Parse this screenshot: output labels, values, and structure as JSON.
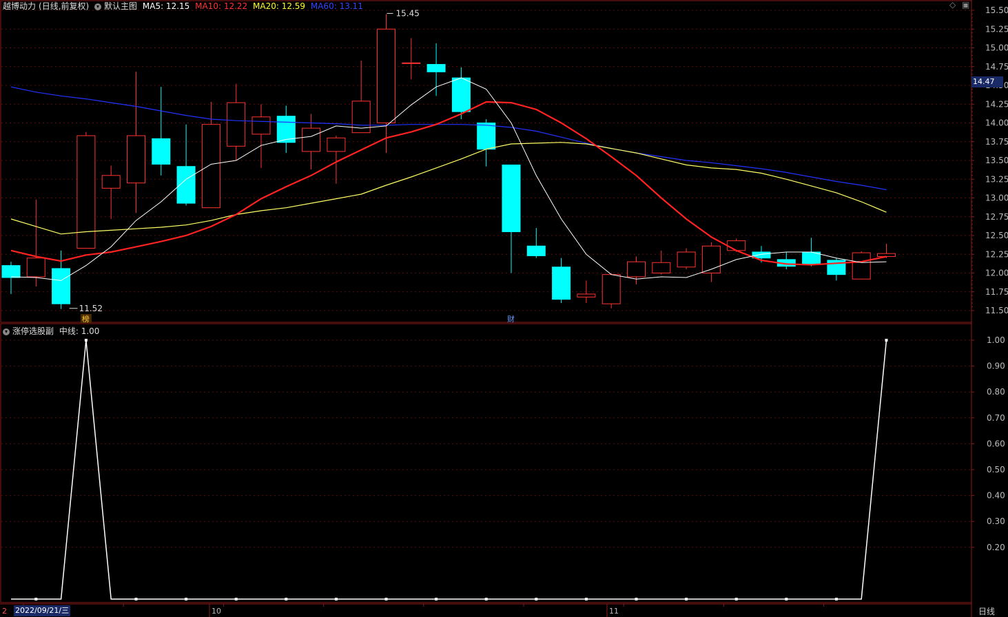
{
  "header": {
    "stock_name": "越博动力",
    "mode": "(日线,前复权)",
    "main_menu": "默认主图",
    "ma5": "MA5: 12.15",
    "ma10": "MA10: 12.22",
    "ma20": "MA20: 12.59",
    "ma60": "MA60: 13.11"
  },
  "sub_header": {
    "indicator": "涨停选股副",
    "mid_line": "中线: 1.00"
  },
  "price_axis": [
    "15.50",
    "15.25",
    "15.00",
    "14.75",
    "14.50",
    "14.25",
    "14.00",
    "13.75",
    "13.50",
    "13.25",
    "13.00",
    "12.75",
    "12.50",
    "12.25",
    "12.00",
    "11.75",
    "11.50"
  ],
  "current_price": "14.47",
  "indicator_axis": [
    "1.00",
    "0.90",
    "0.80",
    "0.70",
    "0.60",
    "0.50",
    "0.40",
    "0.30",
    "0.20"
  ],
  "annotations": {
    "high": "15.45",
    "low": "11.52",
    "bang": "榜",
    "cai": "财"
  },
  "x_axis": {
    "date": "2022/09/21/三",
    "left_mark": "2",
    "oct": "10",
    "nov": "11"
  },
  "period_button": "日线",
  "colors": {
    "up": "#ff3333",
    "down": "#00ffff",
    "ma5": "#ffffff",
    "ma10": "#ff2222",
    "ma20": "#ffff66",
    "ma60": "#2233ff",
    "axis": "#8b1a1a",
    "grid": "#5a0f0f"
  },
  "chart_data": [
    {
      "type": "candlestick",
      "price_range": [
        11.45,
        15.55
      ],
      "candles": [
        {
          "o": 12.1,
          "h": 12.15,
          "l": 11.72,
          "c": 11.94
        },
        {
          "o": 11.95,
          "h": 12.98,
          "l": 11.82,
          "c": 12.2
        },
        {
          "o": 12.06,
          "h": 12.3,
          "l": 11.52,
          "c": 11.59
        },
        {
          "o": 12.33,
          "h": 13.88,
          "l": 12.33,
          "c": 13.83
        },
        {
          "o": 13.13,
          "h": 13.43,
          "l": 12.72,
          "c": 13.3
        },
        {
          "o": 13.2,
          "h": 14.68,
          "l": 12.8,
          "c": 13.83
        },
        {
          "o": 13.79,
          "h": 14.48,
          "l": 13.3,
          "c": 13.45
        },
        {
          "o": 13.42,
          "h": 13.98,
          "l": 12.9,
          "c": 12.93
        },
        {
          "o": 12.87,
          "h": 14.28,
          "l": 12.87,
          "c": 13.98
        },
        {
          "o": 13.69,
          "h": 14.52,
          "l": 13.5,
          "c": 14.27
        },
        {
          "o": 13.85,
          "h": 14.25,
          "l": 13.4,
          "c": 14.08
        },
        {
          "o": 14.09,
          "h": 14.23,
          "l": 13.6,
          "c": 13.74
        },
        {
          "o": 13.62,
          "h": 14.12,
          "l": 13.38,
          "c": 13.93
        },
        {
          "o": 13.62,
          "h": 13.83,
          "l": 13.19,
          "c": 13.8
        },
        {
          "o": 13.87,
          "h": 14.83,
          "l": 13.87,
          "c": 14.29
        },
        {
          "o": 14.0,
          "h": 15.45,
          "l": 13.6,
          "c": 15.25
        },
        {
          "o": 14.8,
          "h": 15.13,
          "l": 14.58,
          "c": 14.8
        },
        {
          "o": 14.78,
          "h": 15.06,
          "l": 14.36,
          "c": 14.68
        },
        {
          "o": 14.6,
          "h": 14.74,
          "l": 14.05,
          "c": 14.15
        },
        {
          "o": 14.0,
          "h": 14.05,
          "l": 13.42,
          "c": 13.65
        },
        {
          "o": 13.44,
          "h": 13.44,
          "l": 12.0,
          "c": 12.55
        },
        {
          "o": 12.36,
          "h": 12.6,
          "l": 12.2,
          "c": 12.23
        },
        {
          "o": 12.08,
          "h": 12.2,
          "l": 11.6,
          "c": 11.65
        },
        {
          "o": 11.68,
          "h": 11.9,
          "l": 11.6,
          "c": 11.72
        },
        {
          "o": 11.59,
          "h": 12.0,
          "l": 11.53,
          "c": 11.98
        },
        {
          "o": 11.95,
          "h": 12.22,
          "l": 11.85,
          "c": 12.15
        },
        {
          "o": 12.0,
          "h": 12.3,
          "l": 11.98,
          "c": 12.14
        },
        {
          "o": 12.08,
          "h": 12.33,
          "l": 12.05,
          "c": 12.28
        },
        {
          "o": 12.0,
          "h": 12.41,
          "l": 11.88,
          "c": 12.36
        },
        {
          "o": 12.3,
          "h": 12.46,
          "l": 12.28,
          "c": 12.43
        },
        {
          "o": 12.28,
          "h": 12.36,
          "l": 12.14,
          "c": 12.2
        },
        {
          "o": 12.18,
          "h": 12.28,
          "l": 12.05,
          "c": 12.09
        },
        {
          "o": 12.28,
          "h": 12.47,
          "l": 12.09,
          "c": 12.12
        },
        {
          "o": 12.17,
          "h": 12.2,
          "l": 11.9,
          "c": 11.98
        },
        {
          "o": 11.92,
          "h": 12.29,
          "l": 11.92,
          "c": 12.27
        },
        {
          "o": 12.22,
          "h": 12.39,
          "l": 12.2,
          "c": 12.26
        }
      ],
      "ma5": [
        11.95,
        11.94,
        11.9,
        12.1,
        12.35,
        12.7,
        12.95,
        13.25,
        13.45,
        13.5,
        13.7,
        13.78,
        13.82,
        13.96,
        13.93,
        13.96,
        14.24,
        14.48,
        14.6,
        14.45,
        14.0,
        13.3,
        12.72,
        12.25,
        11.98,
        11.92,
        11.95,
        11.94,
        12.05,
        12.18,
        12.25,
        12.28,
        12.28,
        12.2,
        12.14,
        12.15
      ],
      "ma10": [
        12.3,
        12.22,
        12.16,
        12.24,
        12.28,
        12.35,
        12.42,
        12.5,
        12.62,
        12.78,
        12.99,
        13.15,
        13.3,
        13.48,
        13.64,
        13.8,
        13.88,
        13.98,
        14.12,
        14.28,
        14.27,
        14.18,
        14.0,
        13.79,
        13.55,
        13.3,
        13.0,
        12.72,
        12.48,
        12.3,
        12.17,
        12.12,
        12.11,
        12.13,
        12.15,
        12.22
      ],
      "ma20": [
        12.72,
        12.62,
        12.52,
        12.55,
        12.57,
        12.59,
        12.61,
        12.64,
        12.7,
        12.78,
        12.83,
        12.87,
        12.93,
        12.99,
        13.05,
        13.17,
        13.28,
        13.4,
        13.52,
        13.65,
        13.72,
        13.73,
        13.74,
        13.72,
        13.66,
        13.6,
        13.52,
        13.44,
        13.4,
        13.38,
        13.33,
        13.25,
        13.16,
        13.07,
        12.95,
        12.81
      ],
      "ma60": [
        14.48,
        14.41,
        14.36,
        14.32,
        14.27,
        14.22,
        14.16,
        14.1,
        14.05,
        14.03,
        14.02,
        14.01,
        14.0,
        13.99,
        13.97,
        13.97,
        13.98,
        13.98,
        13.98,
        13.97,
        13.94,
        13.89,
        13.81,
        13.73,
        13.66,
        13.6,
        13.55,
        13.5,
        13.47,
        13.43,
        13.39,
        13.34,
        13.28,
        13.22,
        13.17,
        13.11
      ]
    },
    {
      "type": "line",
      "title": "涨停选股副",
      "ylim": [
        0,
        1
      ],
      "values": [
        0,
        0,
        0,
        1,
        0,
        0,
        0,
        0,
        0,
        0,
        0,
        0,
        0,
        0,
        0,
        0,
        0,
        0,
        0,
        0,
        0,
        0,
        0,
        0,
        0,
        0,
        0,
        0,
        0,
        0,
        0,
        0,
        0,
        0,
        0,
        1
      ]
    }
  ]
}
